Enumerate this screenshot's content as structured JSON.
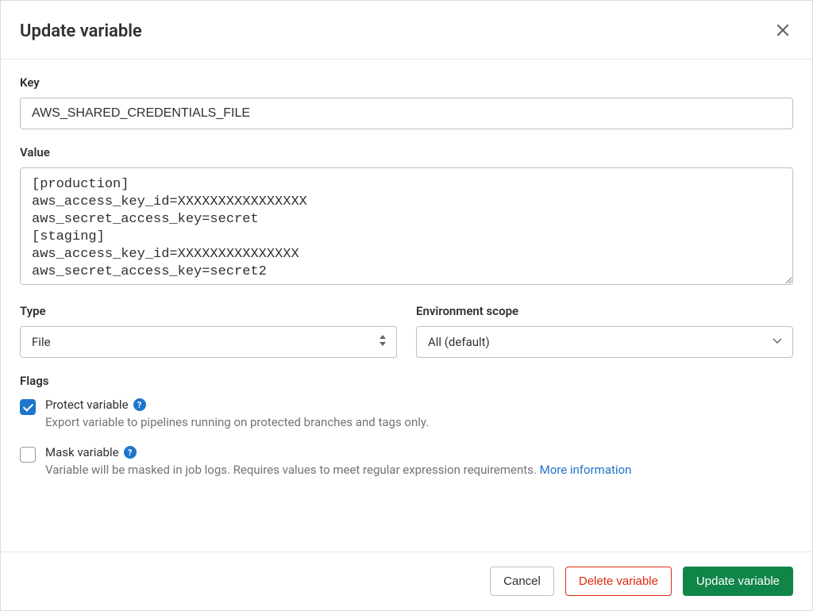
{
  "modal": {
    "title": "Update variable"
  },
  "form": {
    "key": {
      "label": "Key",
      "value": "AWS_SHARED_CREDENTIALS_FILE"
    },
    "value": {
      "label": "Value",
      "value": "[production]\naws_access_key_id=XXXXXXXXXXXXXXXX\naws_secret_access_key=secret\n[staging]\naws_access_key_id=XXXXXXXXXXXXXXX\naws_secret_access_key=secret2"
    },
    "type": {
      "label": "Type",
      "selected": "File"
    },
    "scope": {
      "label": "Environment scope",
      "selected": "All (default)"
    },
    "flags": {
      "label": "Flags",
      "protect": {
        "checked": true,
        "label": "Protect variable",
        "desc": "Export variable to pipelines running on protected branches and tags only."
      },
      "mask": {
        "checked": false,
        "label": "Mask variable",
        "desc_prefix": "Variable will be masked in job logs. Requires values to meet regular expression requirements. ",
        "link_text": "More information"
      }
    }
  },
  "footer": {
    "cancel": "Cancel",
    "delete": "Delete variable",
    "update": "Update variable"
  }
}
